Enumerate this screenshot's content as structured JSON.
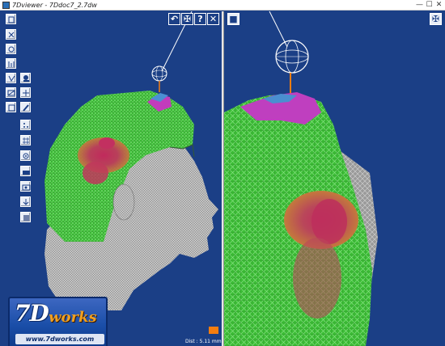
{
  "window": {
    "title": "7Dviewer - 7Ddoc7_2.7dw",
    "min_glyph": "—",
    "max_glyph": "☐",
    "close_glyph": "✕"
  },
  "left_pane": {
    "toolbar_buttons": [
      {
        "name": "view-front-icon"
      },
      {
        "name": "select-tool-icon"
      },
      {
        "name": "zoom-tool-icon"
      },
      {
        "name": "measure-tool-icon"
      },
      {
        "name": "section-tool-icon"
      },
      {
        "name": "light-tool-icon"
      },
      {
        "name": "rotate-tool-icon"
      },
      {
        "name": "pan-tool-icon"
      },
      {
        "name": "frame-tool-icon"
      },
      {
        "name": "annotate-tool-icon"
      },
      {
        "name": "dots-tool-icon"
      },
      {
        "name": "mesh-tool-icon"
      },
      {
        "name": "color-map-icon"
      },
      {
        "name": "texture-icon"
      },
      {
        "name": "camera-icon"
      },
      {
        "name": "export-icon"
      },
      {
        "name": "settings-icon"
      }
    ],
    "top_buttons": [
      {
        "name": "undo-button",
        "glyph": "↶"
      },
      {
        "name": "reset-view-button",
        "glyph": "✠"
      },
      {
        "name": "help-button",
        "glyph": "?"
      },
      {
        "name": "close-view-button",
        "glyph": "✕"
      }
    ],
    "logo": {
      "main": "7D",
      "suffix": "works",
      "url": "www.7dworks.com"
    },
    "distance_label": "Dist : 5.11 mm",
    "colors": {
      "highlight": "#f47d10"
    }
  },
  "right_pane": {
    "top_buttons": [
      {
        "name": "layer-button",
        "glyph": "■"
      },
      {
        "name": "reset-view-button-right",
        "glyph": "✠"
      }
    ]
  },
  "colors": {
    "background": "#1b3f86",
    "mesh_green": "#3fc23a",
    "mesh_gray": "#a9a9a9",
    "hot_red": "#c2315a",
    "warm_orange": "#c9743a",
    "magenta": "#c03cc0"
  }
}
